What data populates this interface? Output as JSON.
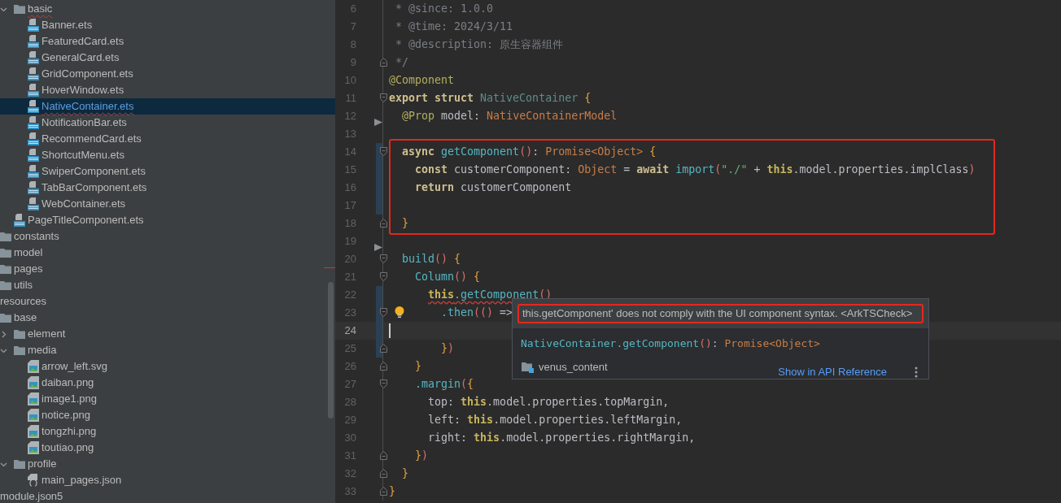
{
  "project_tree": [
    {
      "children": [
        {
          "children": [
            {
              "label": "basic",
              "kind": "folder",
              "expanded": true,
              "selected": false,
              "error": true,
              "children": [
                {
                  "label": "Banner.ets",
                  "kind": "ets",
                  "selected": false,
                  "error": false
                },
                {
                  "label": "FeaturedCard.ets",
                  "kind": "ets",
                  "selected": false,
                  "error": false
                },
                {
                  "label": "GeneralCard.ets",
                  "kind": "ets",
                  "selected": false,
                  "error": false
                },
                {
                  "label": "GridComponent.ets",
                  "kind": "ets",
                  "selected": false,
                  "error": false
                },
                {
                  "label": "HoverWindow.ets",
                  "kind": "ets",
                  "selected": false,
                  "error": false
                },
                {
                  "label": "NativeContainer.ets",
                  "kind": "ets",
                  "selected": true,
                  "error": true
                },
                {
                  "label": "NotificationBar.ets",
                  "kind": "ets",
                  "selected": false,
                  "error": false
                },
                {
                  "label": "RecommendCard.ets",
                  "kind": "ets",
                  "selected": false,
                  "error": false
                },
                {
                  "label": "ShortcutMenu.ets",
                  "kind": "ets",
                  "selected": false,
                  "error": false
                },
                {
                  "label": "SwiperComponent.ets",
                  "kind": "ets",
                  "selected": false,
                  "error": false
                },
                {
                  "label": "TabBarComponent.ets",
                  "kind": "ets",
                  "selected": false,
                  "error": false
                },
                {
                  "label": "WebContainer.ets",
                  "kind": "ets",
                  "selected": false,
                  "error": false
                }
              ]
            },
            {
              "label": "PageTitleComponent.ets",
              "kind": "ets",
              "selected": false,
              "error": false
            }
          ]
        },
        {
          "label": "constants",
          "kind": "folder",
          "selected": false,
          "error": false
        },
        {
          "label": "model",
          "kind": "folder",
          "selected": false,
          "error": false
        },
        {
          "label": "pages",
          "kind": "folder",
          "selected": false,
          "error": false
        },
        {
          "label": "utils",
          "kind": "folder",
          "selected": false,
          "error": false
        }
      ]
    },
    {
      "label": "resources",
      "selected": false,
      "error": false,
      "children": [
        {
          "label": "base",
          "kind": "folder",
          "selected": false,
          "error": false,
          "children": [
            {
              "label": "element",
              "kind": "folder",
              "expanded": false,
              "selected": false,
              "error": false
            },
            {
              "label": "media",
              "kind": "folder",
              "expanded": true,
              "selected": false,
              "error": false,
              "children": [
                {
                  "label": "arrow_left.svg",
                  "kind": "image",
                  "selected": false,
                  "error": false
                },
                {
                  "label": "daiban.png",
                  "kind": "image",
                  "selected": false,
                  "error": false
                },
                {
                  "label": "image1.png",
                  "kind": "image",
                  "selected": false,
                  "error": false
                },
                {
                  "label": "notice.png",
                  "kind": "image",
                  "selected": false,
                  "error": false
                },
                {
                  "label": "tongzhi.png",
                  "kind": "image",
                  "selected": false,
                  "error": false
                },
                {
                  "label": "toutiao.png",
                  "kind": "image",
                  "selected": false,
                  "error": false
                }
              ]
            },
            {
              "label": "profile",
              "kind": "folder",
              "expanded": true,
              "selected": false,
              "error": false,
              "children": [
                {
                  "label": "main_pages.json",
                  "kind": "json",
                  "selected": false,
                  "error": false
                }
              ]
            }
          ]
        }
      ]
    },
    {
      "label": "module.json5",
      "selected": false,
      "error": false
    }
  ],
  "editor": {
    "lines": [
      {
        "n": "6",
        "kind": "plain",
        "changed": false,
        "current": false,
        "boxed": false,
        "tokens": [
          {
            "kind": "c",
            "text": " * @since: 1.0.0"
          }
        ]
      },
      {
        "n": "7",
        "kind": "plain",
        "changed": false,
        "current": false,
        "boxed": false,
        "tokens": [
          {
            "kind": "c",
            "text": " * @time: 2024/3/11"
          }
        ]
      },
      {
        "n": "8",
        "kind": "plain",
        "changed": false,
        "current": false,
        "boxed": false,
        "tokens": [
          {
            "kind": "c",
            "text": " * @description: 原生容器组件"
          }
        ]
      },
      {
        "n": "9",
        "kind": "fold-close",
        "changed": false,
        "current": false,
        "boxed": false,
        "tokens": [
          {
            "kind": "c",
            "text": " */"
          }
        ]
      },
      {
        "n": "10",
        "kind": "plain",
        "changed": false,
        "current": false,
        "boxed": false,
        "tokens": [
          {
            "kind": "dec",
            "text": "@Component"
          }
        ]
      },
      {
        "n": "11",
        "kind": "fold-open",
        "changed": false,
        "current": false,
        "boxed": false,
        "tokens": [
          {
            "kind": "kw",
            "text": "export struct "
          },
          {
            "kind": "cls",
            "text": "NativeContainer "
          },
          {
            "kind": "br",
            "text": "{"
          }
        ]
      },
      {
        "n": "12",
        "kind": "arrow",
        "changed": false,
        "current": false,
        "boxed": false,
        "tokens": [
          {
            "kind": "dec",
            "text": "  @Prop"
          },
          {
            "kind": "p",
            "text": " model: "
          },
          {
            "kind": "ty",
            "text": "NativeContainerModel"
          }
        ]
      },
      {
        "n": "13",
        "kind": "plain",
        "changed": false,
        "current": false,
        "boxed": false
      },
      {
        "n": "14",
        "kind": "fold-open",
        "changed": true,
        "current": false,
        "boxed": true,
        "tokens": [
          {
            "kind": "kw",
            "text": "  async "
          },
          {
            "kind": "fn",
            "text": "getComponent"
          },
          {
            "kind": "pr",
            "text": "()"
          },
          {
            "kind": "p",
            "text": ": "
          },
          {
            "kind": "ty",
            "text": "Promise<Object> "
          },
          {
            "kind": "br",
            "text": "{"
          }
        ]
      },
      {
        "n": "15",
        "kind": "plain",
        "changed": true,
        "current": false,
        "boxed": true,
        "tokens": [
          {
            "kind": "kw",
            "text": "    const "
          },
          {
            "kind": "p",
            "text": "customerComponent: "
          },
          {
            "kind": "ty",
            "text": "Object "
          },
          {
            "kind": "p",
            "text": "= "
          },
          {
            "kind": "kw",
            "text": "await "
          },
          {
            "kind": "fn",
            "text": "import"
          },
          {
            "kind": "pr",
            "text": "("
          },
          {
            "kind": "str",
            "text": "\"./\""
          },
          {
            "kind": "p",
            "text": " + "
          },
          {
            "kind": "th",
            "text": "this"
          },
          {
            "kind": "p",
            "text": ".model.properties.implClass"
          },
          {
            "kind": "pr",
            "text": ")"
          }
        ]
      },
      {
        "n": "16",
        "kind": "plain",
        "changed": true,
        "current": false,
        "boxed": true,
        "tokens": [
          {
            "kind": "kw",
            "text": "    return "
          },
          {
            "kind": "p",
            "text": "customerComponent"
          }
        ]
      },
      {
        "n": "17",
        "kind": "plain",
        "changed": true,
        "current": false,
        "boxed": true
      },
      {
        "n": "18",
        "kind": "fold-close",
        "changed": false,
        "current": false,
        "boxed": true,
        "tokens": [
          {
            "kind": "br",
            "text": "  }"
          }
        ]
      },
      {
        "n": "19",
        "kind": "arrow",
        "changed": false,
        "current": false,
        "boxed": false
      },
      {
        "n": "20",
        "kind": "fold-open",
        "changed": false,
        "current": false,
        "boxed": false,
        "tokens": [
          {
            "kind": "fn",
            "text": "  build"
          },
          {
            "kind": "pr",
            "text": "()"
          },
          {
            "kind": "br",
            "text": " {"
          }
        ]
      },
      {
        "n": "21",
        "kind": "fold-open",
        "changed": false,
        "current": false,
        "boxed": false,
        "tokens": [
          {
            "kind": "fn",
            "text": "    Column"
          },
          {
            "kind": "pr",
            "text": "()"
          },
          {
            "kind": "br",
            "text": " {"
          }
        ]
      },
      {
        "n": "22",
        "kind": "plain",
        "changed": true,
        "current": false,
        "boxed": false,
        "tokens": [
          {
            "kind": "th",
            "text": "      this",
            "error": true
          },
          {
            "kind": "fn",
            "text": ".getComponent",
            "error": true
          },
          {
            "kind": "pr",
            "text": "()"
          }
        ]
      },
      {
        "n": "23",
        "kind": "fold-open",
        "changed": true,
        "current": false,
        "boxed": false,
        "bulb": true,
        "tokens": [
          {
            "kind": "fn",
            "text": "        .then"
          },
          {
            "kind": "pr",
            "text": "(() "
          },
          {
            "kind": "p",
            "text": "=>"
          }
        ]
      },
      {
        "n": "24",
        "kind": "plain",
        "changed": true,
        "current": true,
        "boxed": false
      },
      {
        "n": "25",
        "kind": "fold-close",
        "changed": true,
        "current": false,
        "boxed": false,
        "tokens": [
          {
            "kind": "br",
            "text": "        }"
          },
          {
            "kind": "pr",
            "text": ")"
          }
        ]
      },
      {
        "n": "26",
        "kind": "fold-close",
        "changed": false,
        "current": false,
        "boxed": false,
        "tokens": [
          {
            "kind": "br",
            "text": "    }"
          }
        ]
      },
      {
        "n": "27",
        "kind": "fold-open",
        "changed": false,
        "current": false,
        "boxed": false,
        "tokens": [
          {
            "kind": "fn",
            "text": "    .margin"
          },
          {
            "kind": "pr",
            "text": "("
          },
          {
            "kind": "br",
            "text": "{"
          }
        ]
      },
      {
        "n": "28",
        "kind": "plain",
        "changed": false,
        "current": false,
        "boxed": false,
        "tokens": [
          {
            "kind": "p",
            "text": "      top: "
          },
          {
            "kind": "th",
            "text": "this"
          },
          {
            "kind": "p",
            "text": ".model.properties.topMargin,"
          }
        ]
      },
      {
        "n": "29",
        "kind": "plain",
        "changed": false,
        "current": false,
        "boxed": false,
        "tokens": [
          {
            "kind": "p",
            "text": "      left: "
          },
          {
            "kind": "th",
            "text": "this"
          },
          {
            "kind": "p",
            "text": ".model.properties.leftMargin,"
          }
        ]
      },
      {
        "n": "30",
        "kind": "plain",
        "changed": false,
        "current": false,
        "boxed": false,
        "tokens": [
          {
            "kind": "p",
            "text": "      right: "
          },
          {
            "kind": "th",
            "text": "this"
          },
          {
            "kind": "p",
            "text": ".model.properties.rightMargin,"
          }
        ]
      },
      {
        "n": "31",
        "kind": "fold-close",
        "changed": false,
        "current": false,
        "boxed": false,
        "tokens": [
          {
            "kind": "br",
            "text": "    }"
          },
          {
            "kind": "pr",
            "text": ")"
          }
        ]
      },
      {
        "n": "32",
        "kind": "fold-close",
        "changed": false,
        "current": false,
        "boxed": false,
        "tokens": [
          {
            "kind": "br",
            "text": "  }"
          }
        ]
      },
      {
        "n": "33",
        "kind": "fold-close",
        "changed": false,
        "current": false,
        "boxed": false,
        "tokens": [
          {
            "kind": "br",
            "text": "}"
          }
        ]
      }
    ],
    "popup": {
      "message": "this.getComponent' does not comply with the UI component syntax. <ArkTSCheck>",
      "message_boxed": true,
      "signature": [
        {
          "kind": "fn",
          "text": "NativeContainer.getComponent"
        },
        {
          "kind": "pr",
          "text": "()"
        },
        {
          "kind": "p",
          "text": ": "
        },
        {
          "kind": "ty",
          "text": "Promise<Object>"
        }
      ],
      "location": "venus_content",
      "link": "Show in API Reference"
    }
  }
}
